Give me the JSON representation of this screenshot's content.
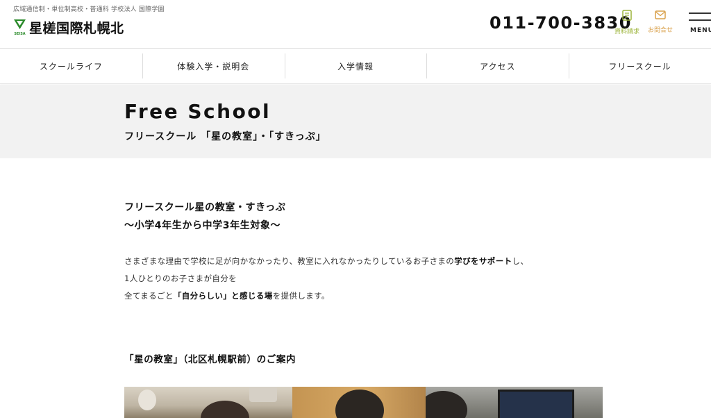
{
  "header": {
    "tagline": "広域通信制・単位制高校・普通科 学校法人 国際学園",
    "logo_mark_text": "SEISA",
    "logo_text": "星槎国際札幌北",
    "phone": "011-700-3830",
    "docs_label": "資料請求",
    "contact_label": "お問合せ",
    "menu_label": "MENU",
    "docs_icon": "document-icon",
    "contact_icon": "mail-icon",
    "colors": {
      "docs": "#9cb43a",
      "contact": "#d9a04a",
      "logo_green": "#2a8a2a"
    }
  },
  "nav": {
    "items": [
      {
        "label": "スクールライフ"
      },
      {
        "label": "体験入学・説明会"
      },
      {
        "label": "入学情報"
      },
      {
        "label": "アクセス"
      },
      {
        "label": "フリースクール"
      }
    ]
  },
  "title_band": {
    "title": "Free School",
    "subtitle": "フリースクール 「星の教室」・「すきっぷ」"
  },
  "main": {
    "intro_line1": "フリースクール星の教室・すきっぷ",
    "intro_line2": "〜小学4年生から中学3年生対象〜",
    "p1_a": "さまざまな理由で学校に足が向かなかったり、教室に入れなかったりしているお子さまの",
    "p1_b": "学びをサポート",
    "p1_c": "し、",
    "p2": "1人ひとりのお子さまが自分を",
    "p3_a": "全てまるごと",
    "p3_b": "「自分らしい」と感じる場",
    "p3_c": "を提供します。",
    "section_heading": "「星の教室」（北区札幌駅前）のご案内"
  }
}
